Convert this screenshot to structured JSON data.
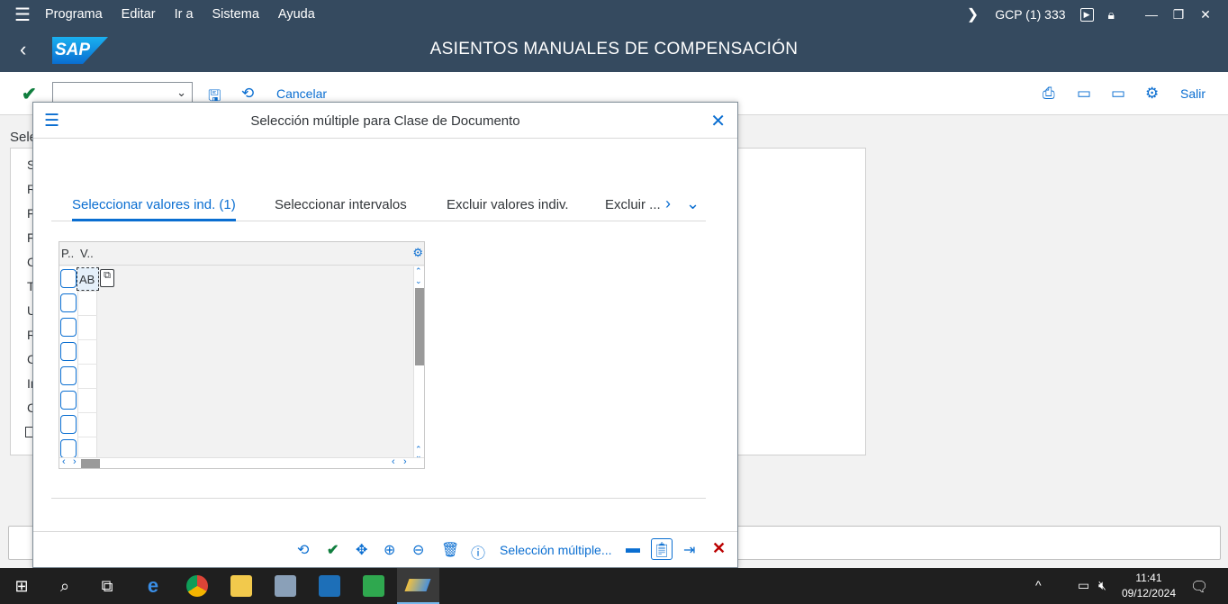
{
  "menubar": {
    "items": [
      "Programa",
      "Editar",
      "Ir a",
      "Sistema",
      "Ayuda"
    ],
    "system": "GCP (1) 333"
  },
  "titlebar": {
    "logo": "SAP",
    "title": "ASIENTOS MANUALES DE COMPENSACIÓN"
  },
  "toolbar": {
    "cancel_label": "Cancelar",
    "exit_label": "Salir",
    "command_value": ""
  },
  "background": {
    "section_label": "Sele",
    "row_letters": [
      "S",
      "R",
      "F",
      "F",
      "C",
      "T",
      "U",
      "R",
      "C",
      "Ir",
      "C"
    ]
  },
  "dialog": {
    "title": "Selección múltiple para Clase de Documento",
    "tabs": [
      "Seleccionar valores ind. (1)",
      "Seleccionar intervalos",
      "Excluir valores indiv.",
      "Excluir ..."
    ],
    "table": {
      "headers": [
        "P..",
        "V.."
      ],
      "first_value": "AB",
      "row_count": 8
    },
    "footer_link": "Selección múltiple..."
  },
  "taskbar": {
    "time": "11:41",
    "date": "09/12/2024"
  }
}
